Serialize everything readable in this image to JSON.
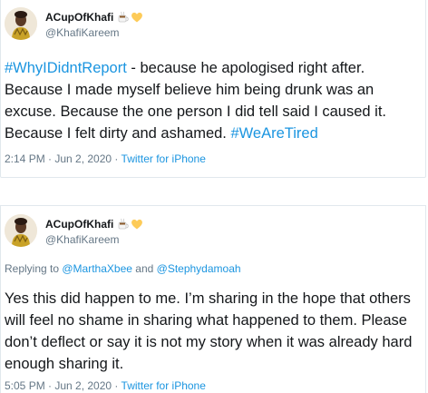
{
  "tweets": [
    {
      "author": {
        "display_name": "ACupOfKhafi",
        "handle": "@KhafiKareem",
        "emoji": [
          "coffee-emoji",
          "yellow-heart-emoji"
        ]
      },
      "body": {
        "hashtag_lead": "#WhyIDidntReport",
        "text": " - because he apologised right after. Because I made myself believe him being drunk was an excuse. Because the one person I did tell said I caused it. Because I felt dirty and ashamed. ",
        "hashtag_tail": "#WeAreTired"
      },
      "timestamp": "2:14 PM · Jun 2, 2020",
      "separator": " · ",
      "source": "Twitter for iPhone"
    },
    {
      "author": {
        "display_name": "ACupOfKhafi",
        "handle": "@KhafiKareem",
        "emoji": [
          "coffee-emoji",
          "yellow-heart-emoji"
        ]
      },
      "reply": {
        "prefix": "Replying to ",
        "mention1": "@MarthaXbee",
        "conjunction": " and ",
        "mention2": "@Stephydamoah"
      },
      "body": {
        "text": "Yes this did happen to me. I’m sharing in the hope that others will feel no shame in sharing what happened to them. Please don’t deflect or say it is not my story when it was already hard enough sharing it."
      },
      "timestamp": "5:05 PM · Jun 2, 2020",
      "separator": " · ",
      "source": "Twitter for iPhone"
    }
  ],
  "colors": {
    "link": "#1b95e0",
    "muted": "#657786",
    "text": "#14171a",
    "border": "#e1e8ed"
  }
}
